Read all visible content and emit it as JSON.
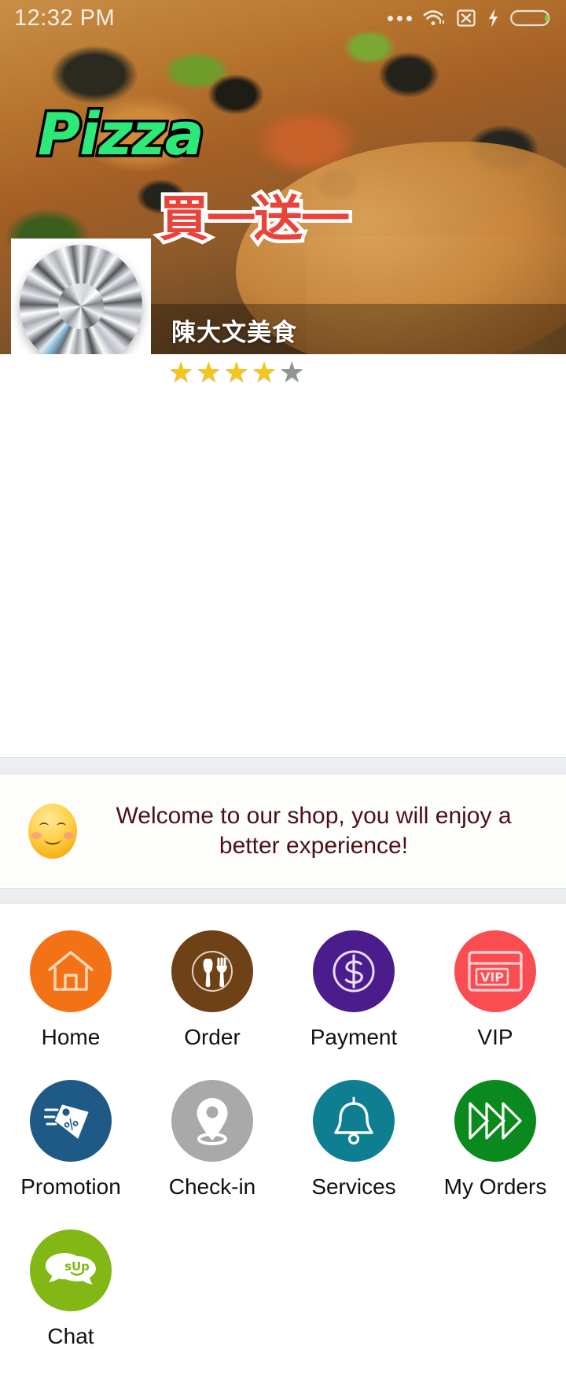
{
  "status_bar": {
    "time": "12:32 PM",
    "icons": [
      "more-dots-icon",
      "wifi-icon",
      "no-sim-icon",
      "charging-bolt-icon",
      "battery-icon"
    ]
  },
  "hero": {
    "title": "Pizza",
    "promo_text": "買一送一",
    "shop_name": "陳大文美食",
    "avatar": "diamond-avatar",
    "title_color": "#2ee877",
    "promo_color": "#e8443c"
  },
  "rating": {
    "filled": 4,
    "total": 5,
    "star_glyph": "★",
    "filled_color": "#f5c518",
    "empty_color": "#8e9396"
  },
  "welcome": {
    "emoji": "smiling-face-emoji",
    "message": "Welcome to our shop, you will enjoy a better experience!",
    "text_color": "#4a1118"
  },
  "grid": {
    "rows": [
      [
        {
          "label": "Home",
          "icon": "house-icon",
          "color": "#f47216"
        },
        {
          "label": "Order",
          "icon": "cutlery-icon",
          "color": "#6e4117"
        },
        {
          "label": "Payment",
          "icon": "dollar-coin-icon",
          "color": "#4b1d8c"
        },
        {
          "label": "VIP",
          "icon": "vip-card-icon",
          "color": "#f94d52"
        }
      ],
      [
        {
          "label": "Promotion",
          "icon": "price-tag-icon",
          "color": "#1f5a86"
        },
        {
          "label": "Check-in",
          "icon": "map-pin-icon",
          "color": "#a9a9a9"
        },
        {
          "label": "Services",
          "icon": "bell-icon",
          "color": "#0d7f91"
        },
        {
          "label": "My Orders",
          "icon": "triple-arrow-icon",
          "color": "#0a8a1e"
        }
      ],
      [
        {
          "label": "Chat",
          "icon": "chat-bubbles-icon",
          "color": "#82b716",
          "bubble_text": "sUp"
        }
      ]
    ]
  }
}
